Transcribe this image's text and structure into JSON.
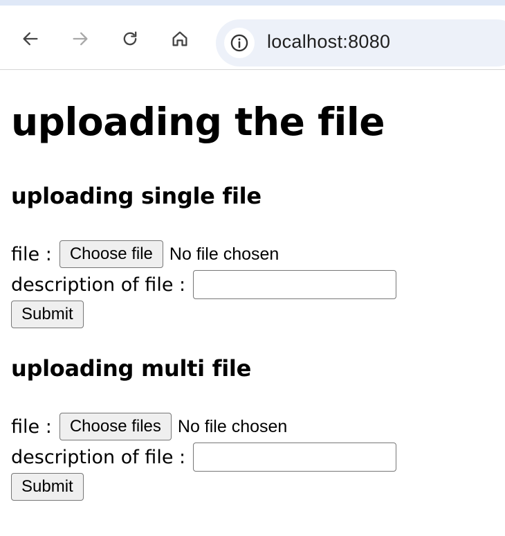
{
  "browser": {
    "url": "localhost:8080",
    "icons": [
      "back-arrow-icon",
      "forward-arrow-icon",
      "reload-icon",
      "home-icon",
      "info-icon"
    ]
  },
  "page": {
    "title": "uploading the file",
    "single": {
      "heading": "uploading single file",
      "file_label": "file :",
      "choose_button": "Choose file",
      "file_status": "No file chosen",
      "description_label": "description of file :",
      "description_value": "",
      "submit_label": "Submit"
    },
    "multi": {
      "heading": "uploading multi file",
      "file_label": "file :",
      "choose_button": "Choose files",
      "file_status": "No file chosen",
      "description_label": "description of file :",
      "description_value": "",
      "submit_label": "Submit"
    }
  }
}
